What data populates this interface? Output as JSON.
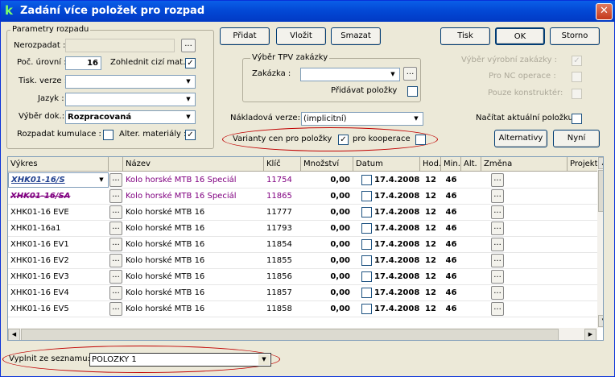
{
  "window": {
    "title": "Zadání více položek pro rozpad",
    "app_icon": "k"
  },
  "params": {
    "legend": "Parametry rozpadu",
    "nerozpadat_label": "Nerozpadat :",
    "poc_urovni_label": "Poč. úrovní :",
    "poc_urovni_value": "16",
    "zohlednit_label": "Zohlednit cizí mat. :",
    "tisk_verze_label": "Tisk. verze :",
    "jazyk_label": "Jazyk :",
    "vyber_dok_label": "Výběr dok.:",
    "vyber_dok_value": "Rozpracovaná",
    "rozpadat_label": "Rozpadat kumulace :",
    "alter_label": "Alter. materiály :"
  },
  "toolbar": {
    "pridat": "Přidat",
    "vlozit": "Vložit",
    "smazat": "Smazat",
    "tisk": "Tisk",
    "ok": "OK",
    "storno": "Storno",
    "alternativy": "Alternativy",
    "nyni": "Nyní"
  },
  "tpv": {
    "legend": "Výběr TPV zakázky",
    "zakazka_label": "Zakázka :",
    "pridavat_label": "Přidávat položky"
  },
  "right": {
    "vyber_vyrobni": "Výběr výrobní zakázky :",
    "pro_nc": "Pro NC operace :",
    "pouze_konstrukter": "Pouze konstruktér:",
    "nacitat": "Načítat aktuální položku"
  },
  "nakladova": {
    "label": "Nákladová verze:",
    "value": "(implicitní)"
  },
  "varianty": {
    "label": "Varianty cen pro položky",
    "kooperace_label": "pro kooperace"
  },
  "grid": {
    "columns": [
      "Výkres",
      "Název",
      "Klíč",
      "Množství",
      "Datum",
      "Hod.",
      "Min.",
      "Alt.",
      "Změna",
      "Projekt"
    ],
    "rows": [
      {
        "vykres": "XHK01-16/S",
        "nazev": "Kolo horské MTB 16 Speciál",
        "klic": "11754",
        "mnozstvi": "0,00",
        "datum": "17.4.2008",
        "hod": "12",
        "min": "46",
        "style": "selected"
      },
      {
        "vykres": "XHK01-16/SA",
        "nazev": "Kolo horské MTB 16 Speciál",
        "klic": "11865",
        "mnozstvi": "0,00",
        "datum": "17.4.2008",
        "hod": "12",
        "min": "46",
        "style": "struck"
      },
      {
        "vykres": "XHK01-16 EVE",
        "nazev": "Kolo horské MTB 16",
        "klic": "11777",
        "mnozstvi": "0,00",
        "datum": "17.4.2008",
        "hod": "12",
        "min": "46",
        "style": "normal"
      },
      {
        "vykres": "XHK01-16a1",
        "nazev": "Kolo horské MTB 16",
        "klic": "11793",
        "mnozstvi": "0,00",
        "datum": "17.4.2008",
        "hod": "12",
        "min": "46",
        "style": "normal"
      },
      {
        "vykres": "XHK01-16 EV1",
        "nazev": "Kolo horské MTB 16",
        "klic": "11854",
        "mnozstvi": "0,00",
        "datum": "17.4.2008",
        "hod": "12",
        "min": "46",
        "style": "normal"
      },
      {
        "vykres": "XHK01-16 EV2",
        "nazev": "Kolo horské MTB 16",
        "klic": "11855",
        "mnozstvi": "0,00",
        "datum": "17.4.2008",
        "hod": "12",
        "min": "46",
        "style": "normal"
      },
      {
        "vykres": "XHK01-16 EV3",
        "nazev": "Kolo horské MTB 16",
        "klic": "11856",
        "mnozstvi": "0,00",
        "datum": "17.4.2008",
        "hod": "12",
        "min": "46",
        "style": "normal"
      },
      {
        "vykres": "XHK01-16 EV4",
        "nazev": "Kolo horské MTB 16",
        "klic": "11857",
        "mnozstvi": "0,00",
        "datum": "17.4.2008",
        "hod": "12",
        "min": "46",
        "style": "normal"
      },
      {
        "vykres": "XHK01-16 EV5",
        "nazev": "Kolo horské MTB 16",
        "klic": "11858",
        "mnozstvi": "0,00",
        "datum": "17.4.2008",
        "hod": "12",
        "min": "46",
        "style": "normal"
      }
    ]
  },
  "footer": {
    "label": "Vyplnit ze seznamu:",
    "value": "POLOZKY 1"
  },
  "colors": {
    "titlebar": "#0349D6",
    "purple": "#800080",
    "ellipse": "#C00000"
  },
  "icons": {
    "close": "close-icon",
    "dropdown": "chevron-down-icon",
    "ellipsis": "ellipsis-icon",
    "check": "check-icon"
  }
}
